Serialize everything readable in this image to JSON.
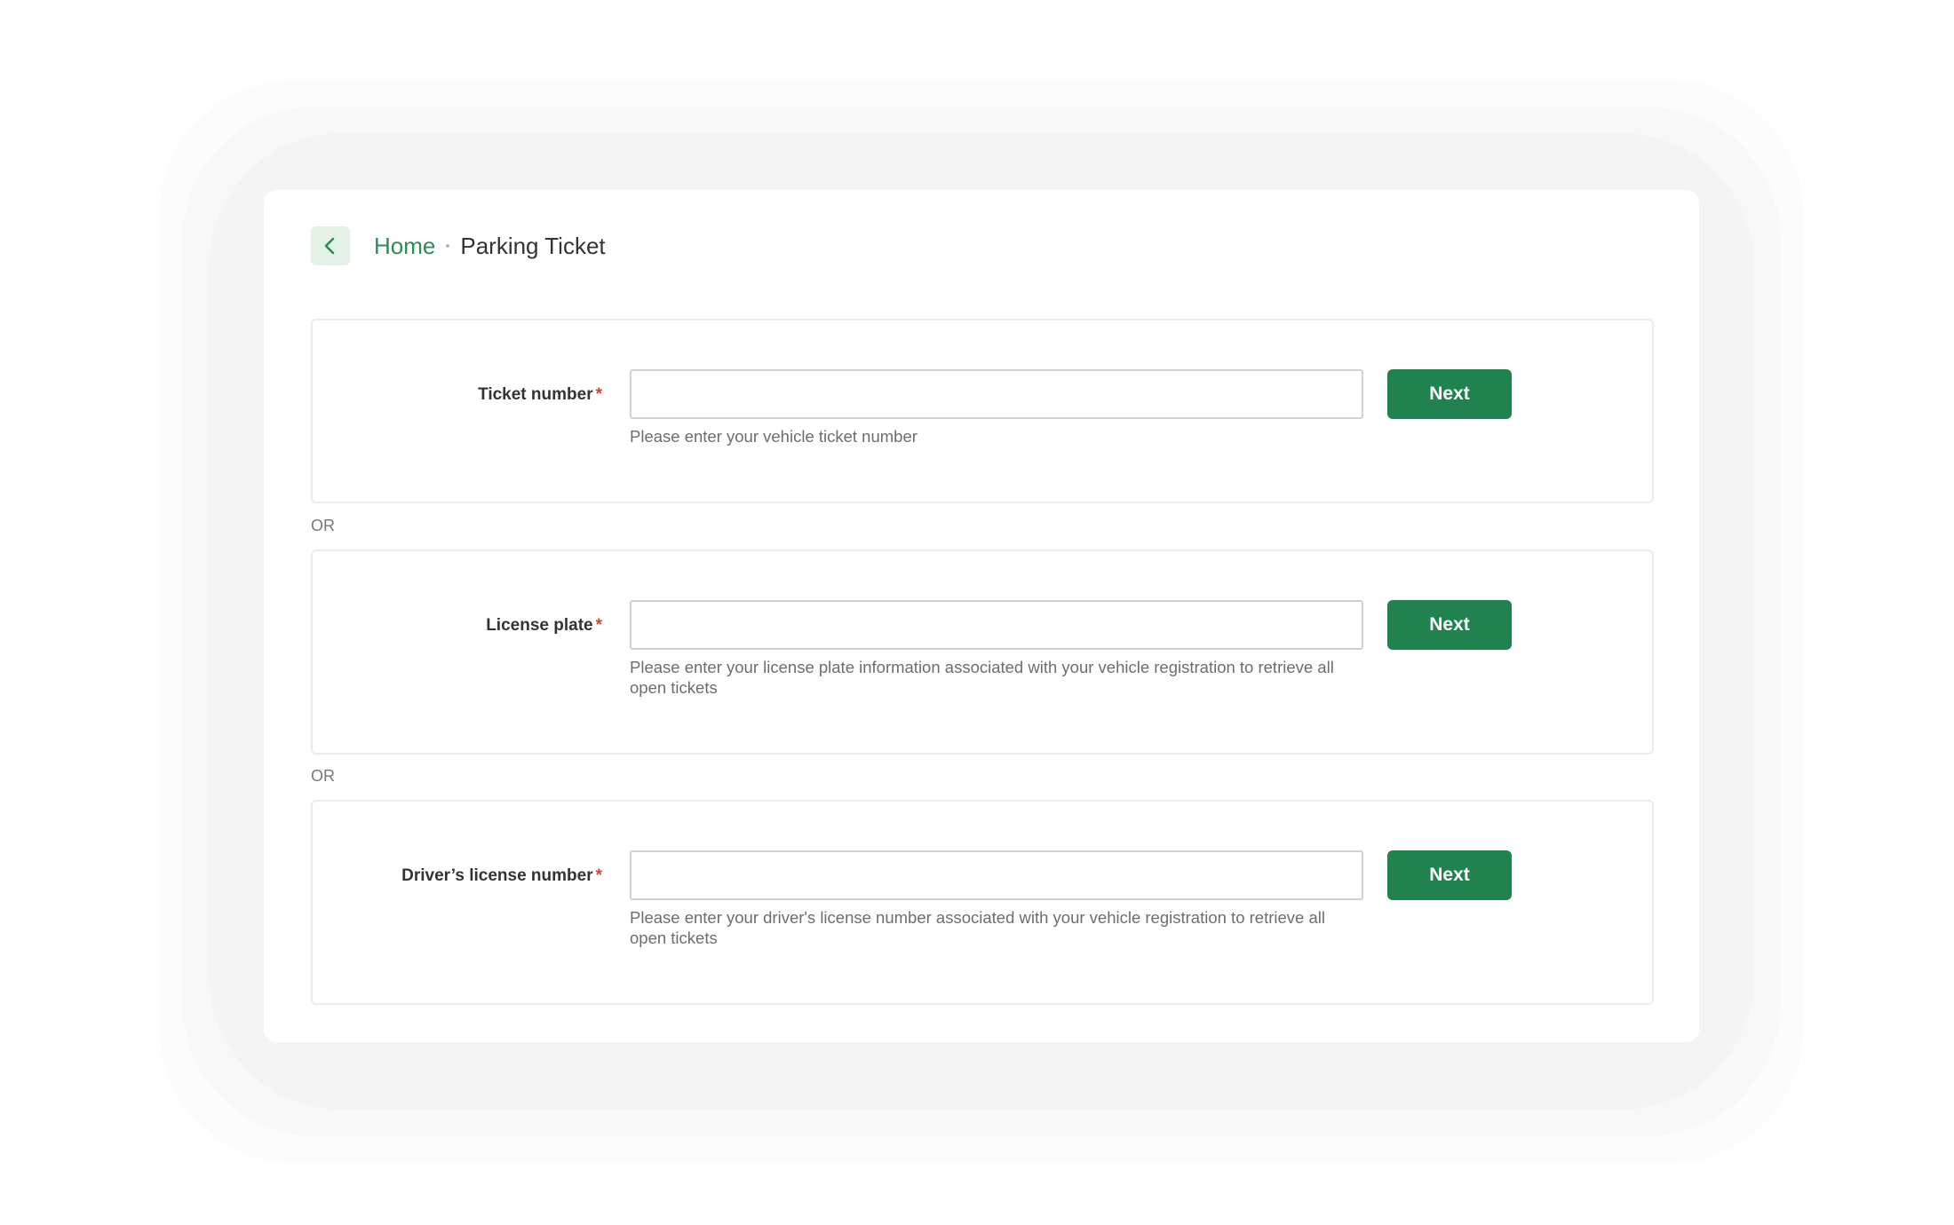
{
  "breadcrumb": {
    "home": "Home",
    "current": "Parking Ticket"
  },
  "sections": [
    {
      "label": "Ticket number",
      "required_mark": "*",
      "input_value": "",
      "help": "Please enter your vehicle ticket number",
      "button": "Next"
    },
    {
      "label": "License plate",
      "required_mark": "*",
      "input_value": "",
      "help": "Please enter your license plate information associated with your vehicle registration to retrieve all open tickets",
      "button": "Next"
    },
    {
      "label": "Driver’s license number",
      "required_mark": "*",
      "input_value": "",
      "help": "Please enter your driver's license number associated with your vehicle registration to retrieve all open tickets",
      "button": "Next"
    }
  ],
  "separator": "OR",
  "colors": {
    "accent": "#20824f",
    "link": "#2e8b57",
    "required": "#e03b2f"
  },
  "icons": {
    "back": "chevron-left-icon"
  }
}
